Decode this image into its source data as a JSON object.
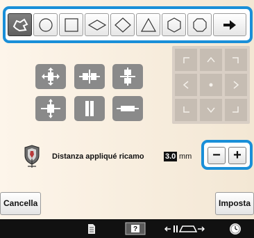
{
  "shape_toolbar": {
    "items": [
      {
        "icon": "freeform-outline-icon",
        "selected": true
      },
      {
        "icon": "circle-outline-icon",
        "selected": false
      },
      {
        "icon": "square-outline-icon",
        "selected": false
      },
      {
        "icon": "flat-diamond-outline-icon",
        "selected": false
      },
      {
        "icon": "diamond-outline-icon",
        "selected": false
      },
      {
        "icon": "triangle-outline-icon",
        "selected": false
      },
      {
        "icon": "hexagon-outline-icon",
        "selected": false
      },
      {
        "icon": "octagon-outline-icon",
        "selected": false
      }
    ],
    "next_icon": "arrow-right-icon"
  },
  "layout_buttons": [
    {
      "icon": "center-layout-icon"
    },
    {
      "icon": "horizontal-layout-icon"
    },
    {
      "icon": "vertical-layout-icon"
    },
    {
      "icon": "spread-layout-icon"
    },
    {
      "icon": "vertical-bar-layout-icon"
    },
    {
      "icon": "horizontal-bar-layout-icon"
    }
  ],
  "position_grid": [
    "top-left-corner-icon",
    "up-arrow-icon",
    "top-right-corner-icon",
    "left-arrow-icon",
    "center-dot-icon",
    "right-arrow-icon",
    "bottom-left-corner-icon",
    "down-arrow-icon",
    "bottom-right-corner-icon"
  ],
  "distance": {
    "icon": "applique-shield-icon",
    "label": "Distanza appliqué ricamo",
    "value": "3.0",
    "unit": "mm",
    "minus_label": "−",
    "plus_label": "+"
  },
  "actions": {
    "cancel_label": "Cancella",
    "set_label": "Imposta"
  },
  "status_bar": {
    "icons": [
      "page-icon",
      "help-icon",
      "thread-tension-icon",
      "clock-icon"
    ]
  },
  "colors": {
    "highlight": "#1a8fd8",
    "background": "#f6ecdd",
    "status_bar": "#111111",
    "layout_button": "#8a8a8a"
  }
}
